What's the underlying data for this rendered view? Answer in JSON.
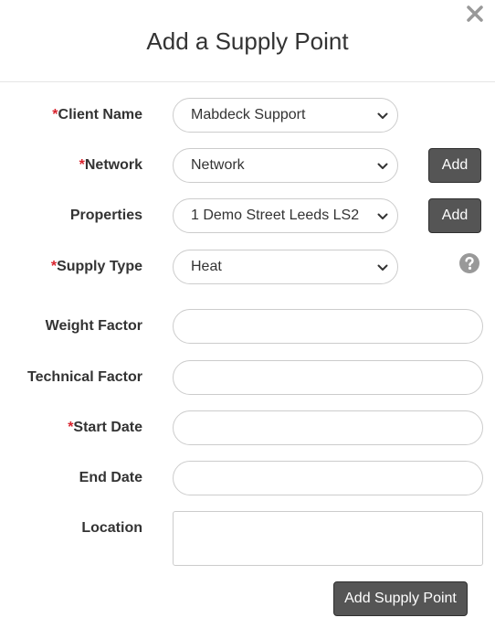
{
  "modal": {
    "title": "Add a Supply Point",
    "close_icon": "close-icon"
  },
  "form": {
    "client_name": {
      "required_mark": "*",
      "label": "Client Name",
      "value": "Mabdeck Support"
    },
    "network": {
      "required_mark": "*",
      "label": "Network",
      "value": "Network",
      "add_label": "Add"
    },
    "properties": {
      "label": "Properties",
      "value": "1 Demo Street Leeds LS2",
      "add_label": "Add"
    },
    "supply_type": {
      "required_mark": "*",
      "label": "Supply Type",
      "value": "Heat",
      "help_icon": "question-circle-icon"
    },
    "weight_factor": {
      "label": "Weight Factor",
      "value": ""
    },
    "technical_factor": {
      "label": "Technical Factor",
      "value": ""
    },
    "start_date": {
      "required_mark": "*",
      "label": "Start Date",
      "value": ""
    },
    "end_date": {
      "label": "End Date",
      "value": ""
    },
    "location": {
      "label": "Location",
      "value": ""
    },
    "submit_label": "Add Supply Point"
  },
  "colors": {
    "required": "#d9232d",
    "button_bg": "#555555",
    "border": "#cccccc",
    "icon_grey": "#999999"
  }
}
